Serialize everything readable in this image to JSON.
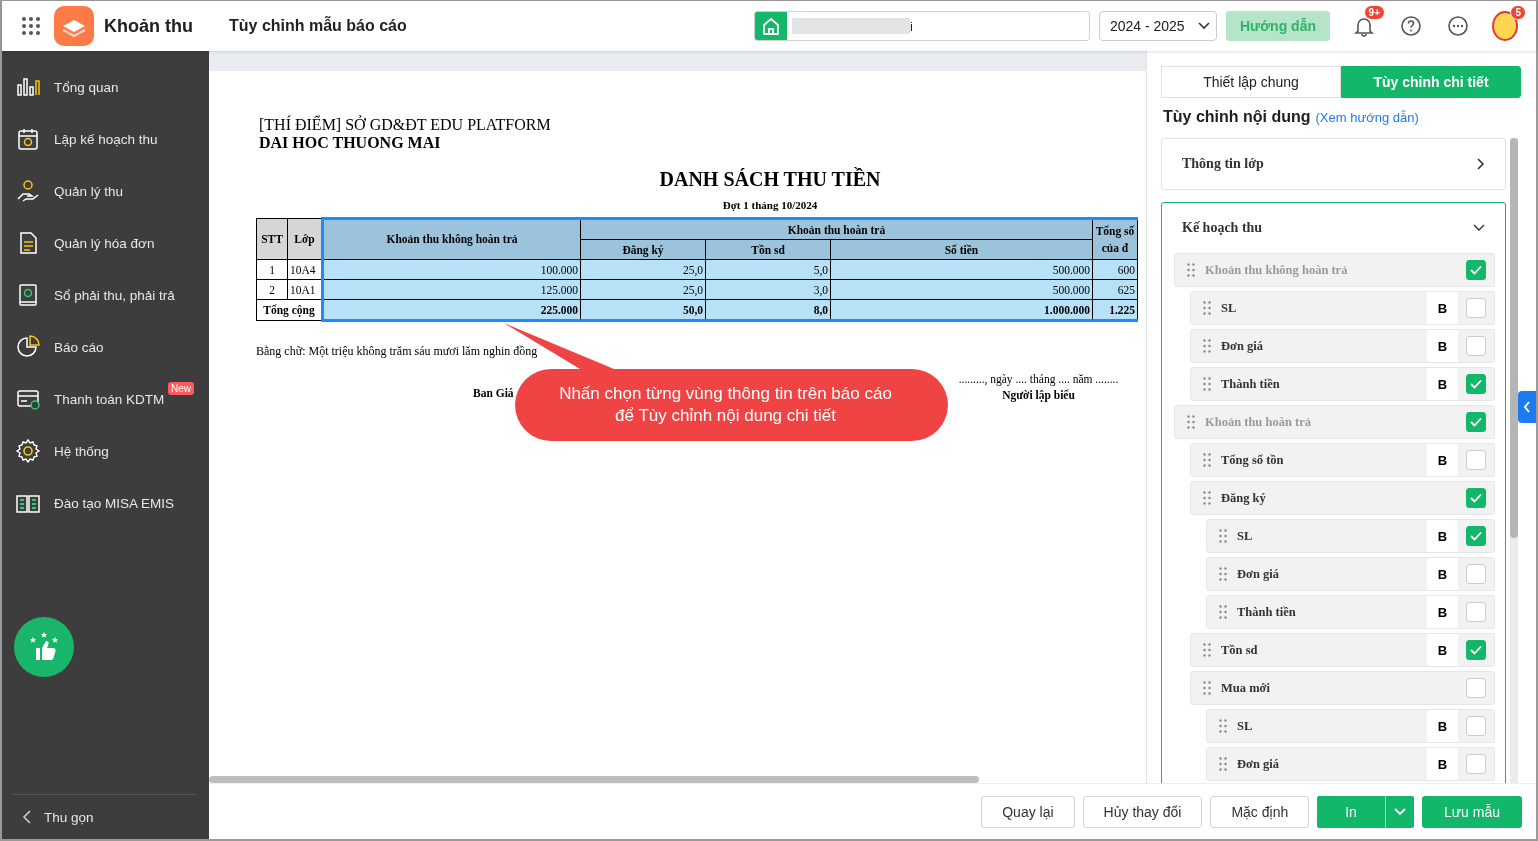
{
  "app": {
    "name": "Khoản thu",
    "page_title": "Tùy chỉnh mẫu báo cáo"
  },
  "topbar": {
    "school_field": {
      "value": "i"
    },
    "year_select": {
      "value": "2024 - 2025"
    },
    "guide_button": "Hướng dẫn",
    "notification_badge": "9+",
    "avatar_badge": "5"
  },
  "sidebar": {
    "items": [
      {
        "label": "Tổng quan"
      },
      {
        "label": "Lập kế hoạch thu"
      },
      {
        "label": "Quản lý thu"
      },
      {
        "label": "Quản lý hóa đơn"
      },
      {
        "label": "Sổ phải thu, phải trả"
      },
      {
        "label": "Báo cáo"
      },
      {
        "label": "Thanh toán KDTM",
        "badge": "New"
      },
      {
        "label": "Hệ thống"
      },
      {
        "label": "Đào tạo MISA EMIS"
      }
    ],
    "collapse": "Thu gọn"
  },
  "report": {
    "org": "[THÍ ĐIỂM] SỞ GD&ĐT EDU PLATFORM",
    "school": "DAI HOC THUONG MAI",
    "title": "DANH SÁCH THU TIỀN",
    "subtitle": "Đợt 1 tháng 10/2024",
    "table": {
      "header_rows": [
        [
          {
            "label": "STT",
            "rowspan": 2,
            "highlighted": false
          },
          {
            "label": "Lớp",
            "rowspan": 2,
            "highlighted": false
          },
          {
            "label": "Khoản thu không hoàn trả",
            "rowspan": 2,
            "highlighted": true
          },
          {
            "label": "Khoản thu hoàn trả",
            "colspan": 3,
            "highlighted": true
          },
          {
            "label": "Tổng số của đ",
            "rowspan": 2,
            "highlighted": true
          }
        ],
        [
          {
            "label": "Đăng ký",
            "highlighted": true
          },
          {
            "label": "Tồn sd",
            "highlighted": true
          },
          {
            "label": "Số tiền",
            "highlighted": true
          }
        ]
      ],
      "rows": [
        {
          "cells": [
            "1",
            "10A4",
            "100.000",
            "25,0",
            "5,0",
            "500.000",
            "600"
          ]
        },
        {
          "cells": [
            "2",
            "10A1",
            "125.000",
            "25,0",
            "3,0",
            "500.000",
            "625"
          ]
        }
      ],
      "total": {
        "label": "Tổng cộng",
        "cells": [
          "225.000",
          "50,0",
          "8,0",
          "1.000.000",
          "1.225"
        ]
      }
    },
    "amount_in_words": "Bằng chữ: Một triệu không trăm sáu mươi lăm nghin đồng",
    "signatures": {
      "left": "Ban Giá",
      "date_line": "........., ngày .... tháng .... năm ........",
      "right": "Người lập biểu"
    },
    "callout": "Nhấn chọn từng vùng thông tin trên báo cáo để Tùy chỉnh nội dung chi tiết"
  },
  "panel": {
    "tabs": [
      {
        "label": "Thiết lập chung",
        "selected": false
      },
      {
        "label": "Tùy chỉnh chi tiết",
        "selected": true
      }
    ],
    "heading": "Tùy chỉnh nội dung",
    "guide_link": "(Xem hướng dẫn)",
    "sections": [
      {
        "label": "Thông tin lớp",
        "expanded": false
      },
      {
        "label": "Kế hoạch thu",
        "expanded": true,
        "children": [
          {
            "label": "Khoản thu không hoàn trả",
            "disabled": true,
            "checked": true,
            "children": [
              {
                "label": "SL",
                "bold_label": "B",
                "disabled": false,
                "checked": false
              },
              {
                "label": "Đơn giá",
                "bold_label": "B",
                "disabled": false,
                "checked": false
              },
              {
                "label": "Thành tiền",
                "bold_label": "B",
                "disabled": false,
                "checked": true
              }
            ]
          },
          {
            "label": "Khoản thu hoàn trả",
            "disabled": true,
            "checked": true,
            "children": [
              {
                "label": "Tổng số tồn",
                "bold_label": "B",
                "disabled": false,
                "checked": false
              },
              {
                "label": "Đăng ký",
                "disabled": false,
                "checked": true,
                "children": [
                  {
                    "label": "SL",
                    "bold_label": "B",
                    "disabled": false,
                    "checked": true
                  },
                  {
                    "label": "Đơn giá",
                    "bold_label": "B",
                    "disabled": false,
                    "checked": false
                  },
                  {
                    "label": "Thành tiền",
                    "bold_label": "B",
                    "disabled": false,
                    "checked": false
                  }
                ]
              },
              {
                "label": "Tồn sd",
                "bold_label": "B",
                "disabled": false,
                "checked": true
              },
              {
                "label": "Mua mới",
                "disabled": false,
                "checked": false,
                "children": [
                  {
                    "label": "SL",
                    "bold_label": "B",
                    "disabled": false,
                    "checked": false
                  },
                  {
                    "label": "Đơn giá",
                    "bold_label": "B",
                    "disabled": false,
                    "checked": false
                  }
                ]
              }
            ]
          }
        ]
      }
    ]
  },
  "footer": {
    "buttons": [
      {
        "label": "Quay lại",
        "kind": "plain"
      },
      {
        "label": "Hủy thay đổi",
        "kind": "plain"
      },
      {
        "label": "Mặc định",
        "kind": "plain"
      },
      {
        "label": "In",
        "kind": "split"
      },
      {
        "label": "Lưu mẫu",
        "kind": "primary"
      }
    ]
  }
}
